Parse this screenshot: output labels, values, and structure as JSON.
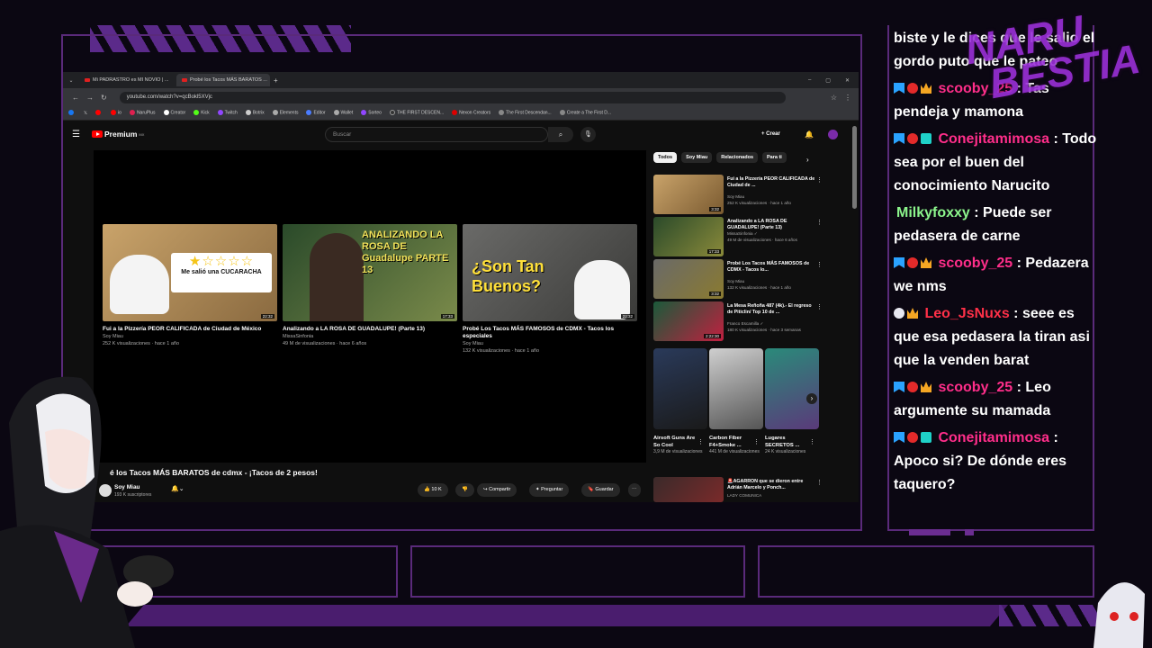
{
  "browser": {
    "tabs": [
      {
        "label": "Mi PADRASTRO es MI NOVIO | ..."
      },
      {
        "label": "Probé los Tacos MÁS BARATOS ..."
      }
    ],
    "new_tab": "+",
    "window_controls": [
      "–",
      "▢",
      "✕"
    ],
    "url": "youtube.com/watch?v=qcBokl5XVjc",
    "bookmarks": [
      "io",
      "NaruPlus",
      "Creator",
      "Kick",
      "Twitch",
      "Botrix",
      "Elements",
      "Editor",
      "Wallet",
      "Sorteo",
      "THE FIRST DESCEN...",
      "Nexon Creators",
      "The First Descendan...",
      "Create a The First D..."
    ]
  },
  "youtube": {
    "logo": "Premium",
    "logo_sup": "MX",
    "search_placeholder": "Buscar",
    "create_label": "Crear",
    "endcards": [
      {
        "title": "Fui a la Pizzería PEOR CALIFICADA de Ciudad de México",
        "channel": "Soy Miau",
        "meta": "252 K visualizaciones · hace 1 año",
        "duration": "22:32",
        "caption": "Me salió una CUCARACHA"
      },
      {
        "title": "Analizando a LA ROSA DE GUADALUPE! (Parte 13)",
        "channel": "MissaSinfonia",
        "meta": "49 M de visualizaciones · hace 6 años",
        "duration": "17:33",
        "caption": "ANALIZANDO LA ROSA DE Guadalupe PARTE 13"
      },
      {
        "title": "Probé Los Tacos MÁS FAMOSOS de CDMX - Tacos los especiales",
        "channel": "Soy Miau",
        "meta": "132 K visualizaciones · hace 1 año",
        "duration": "22:32",
        "caption": "¿Son Tan Buenos?"
      }
    ],
    "video_title": "é los Tacos MÁS BARATOS de cdmx - ¡Tacos de 2 pesos!",
    "channel_name": "Soy Miau",
    "channel_subs": "193 K suscriptores",
    "actions": {
      "likes": "10 K",
      "share": "Compartir",
      "ask": "Preguntar",
      "save": "Guardar"
    },
    "chips": [
      "Todos",
      "Soy Miau",
      "Relacionados",
      "Para ti"
    ],
    "recommendations": [
      {
        "title": "Fui a la Pizzería PEOR CALIFICADA de Ciudad de ...",
        "channel": "Soy Miau",
        "meta": "252 K visualizaciones · hace 1 año",
        "duration": "3:32"
      },
      {
        "title": "Analizando a LA ROSA DE GUADALUPE! (Parte 13)",
        "channel": "MissaSinfonia ✓",
        "meta": "49 M de visualizaciones · hace 6 años",
        "duration": "17:33"
      },
      {
        "title": "Probé Los Tacos MÁS FAMOSOS de CDMX - Tacos lo...",
        "channel": "Soy Miau",
        "meta": "132 K visualizaciones · hace 1 año",
        "duration": "3:32"
      },
      {
        "title": "La Mesa Reñoña 487 (4k).- El regreso de Piticlin/ Top 10 de ...",
        "channel": "Franco Escamilla ✓",
        "meta": "180 K visualizaciones · hace 3 semanas",
        "duration": "2:22:30"
      }
    ],
    "shorts": [
      {
        "title": "Airsoft Guns Are So Cool",
        "meta": "3,9 M de visualizaciones"
      },
      {
        "title": "Carbon Fiber F4+Smoke ...",
        "meta": "441 M de visualizaciones"
      },
      {
        "title": "Lugares SECRETOS ...",
        "meta": "24 K visualizaciones"
      }
    ],
    "last_rec": {
      "title": "🚨AGARRON que se dieron entre Adrián Marcelo y Ponch...",
      "channel": "LADY COMUNICA"
    }
  },
  "chat": {
    "messages": [
      {
        "user": "",
        "text": "biste y le dices que le salio el gordo puto que le pateo",
        "badges": [],
        "color": ""
      },
      {
        "user": "scooby_25",
        "text": ": Tas pendeja y mamona",
        "badges": [
          "prime",
          "red",
          "crown"
        ],
        "color": "#ff2e8a"
      },
      {
        "user": "Conejitamimosa",
        "text": ": Todo sea por el buen del conocimiento Narucito",
        "badges": [
          "prime",
          "red",
          "sub"
        ],
        "color": "#ff2e8a"
      },
      {
        "user": "Milkyfoxxy",
        "text": ": Puede ser pedasera de carne",
        "badges": [],
        "color": "#8cf58c"
      },
      {
        "user": "scooby_25",
        "text": ": Pedazera we nms",
        "badges": [
          "prime",
          "red",
          "crown"
        ],
        "color": "#ff2e8a"
      },
      {
        "user": "Leo_JsNuxs",
        "text": ": seee es que esa pedasera la tiran asi que la venden barat",
        "badges": [
          "white",
          "crown"
        ],
        "color": "#ff3048"
      },
      {
        "user": "scooby_25",
        "text": ": Leo argumente su mamada",
        "badges": [
          "prime",
          "red",
          "crown"
        ],
        "color": "#ff2e8a"
      },
      {
        "user": "Conejitamimosa",
        "text": ": Apoco si? De dónde eres taquero?",
        "badges": [
          "prime",
          "red",
          "sub"
        ],
        "color": "#ff2e8a"
      }
    ]
  },
  "overlay": {
    "logo_line1": "NARU",
    "logo_line2": "BESTIA"
  }
}
